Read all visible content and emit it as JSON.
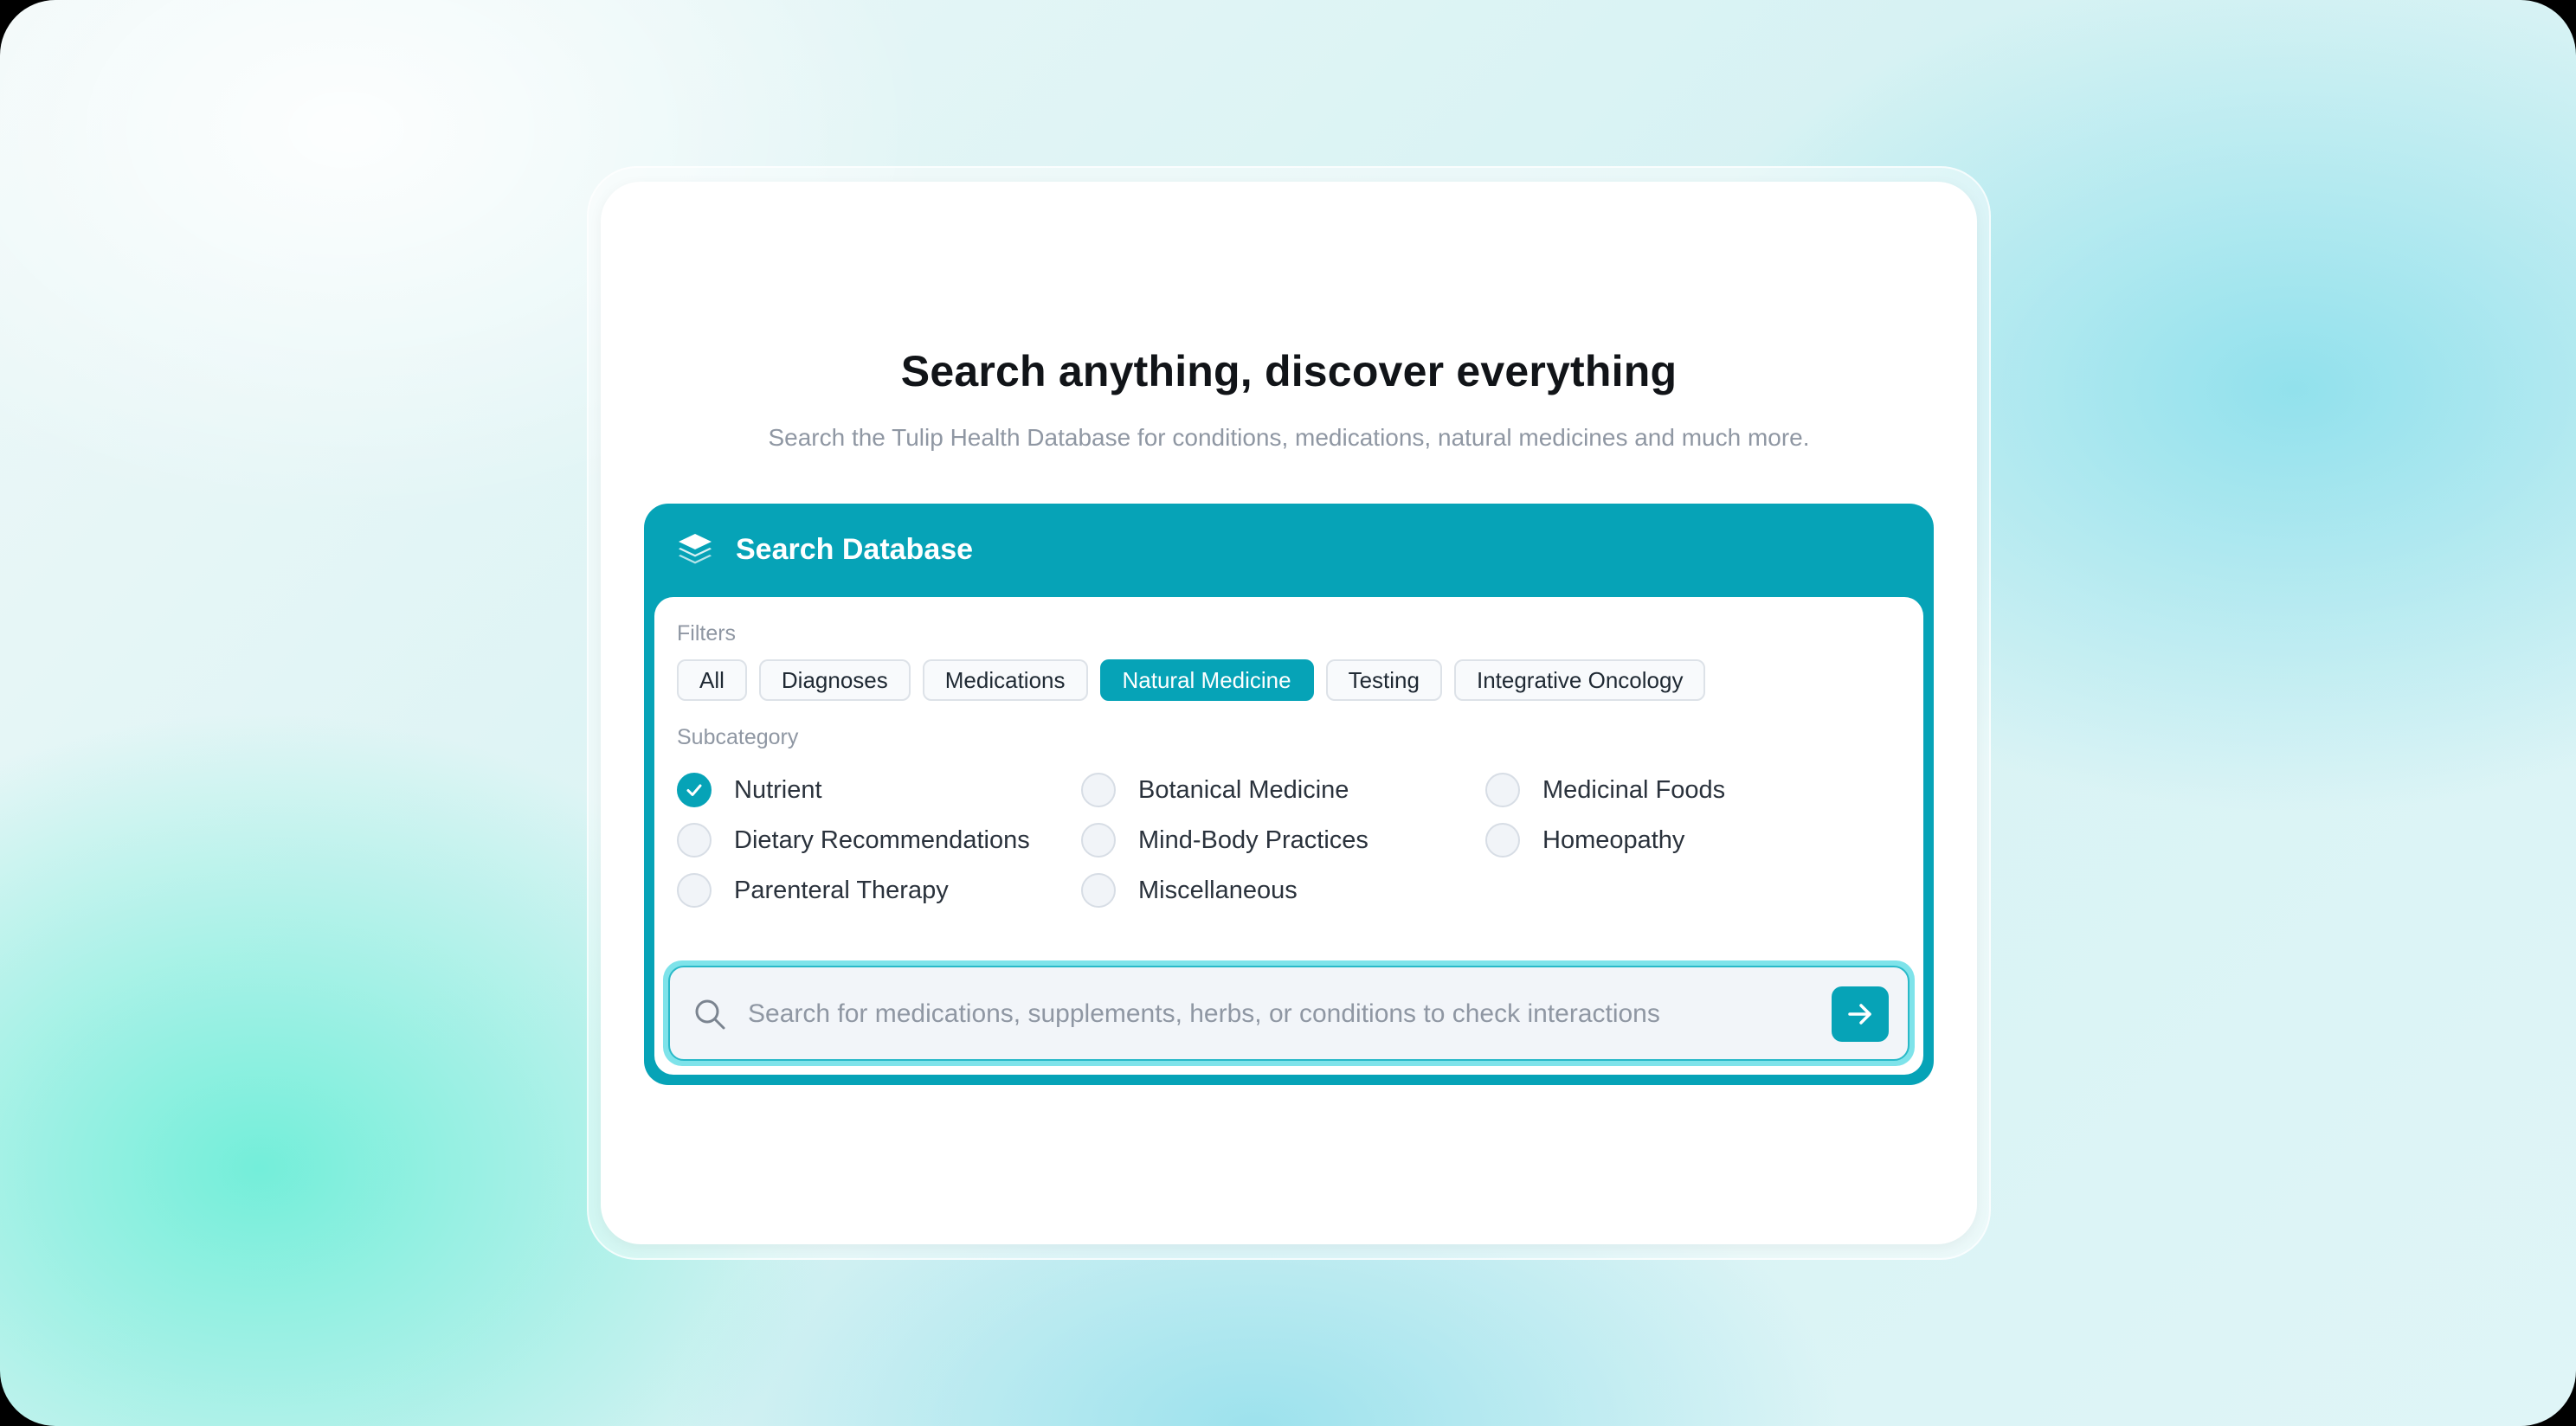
{
  "hero": {
    "title": "Search anything, discover everything",
    "subtitle": "Search the Tulip Health Database for conditions, medications, natural medicines and much more."
  },
  "panel": {
    "title": "Search Database",
    "icon": "layers-icon",
    "accent_color": "#06a3b7"
  },
  "filters": {
    "label": "Filters",
    "items": [
      {
        "label": "All",
        "active": false
      },
      {
        "label": "Diagnoses",
        "active": false
      },
      {
        "label": "Medications",
        "active": false
      },
      {
        "label": "Natural Medicine",
        "active": true
      },
      {
        "label": "Testing",
        "active": false
      },
      {
        "label": "Integrative Oncology",
        "active": false
      }
    ]
  },
  "subcategory": {
    "label": "Subcategory",
    "items": [
      {
        "label": "Nutrient",
        "checked": true
      },
      {
        "label": "Botanical Medicine",
        "checked": false
      },
      {
        "label": "Medicinal Foods",
        "checked": false
      },
      {
        "label": "Dietary Recommendations",
        "checked": false
      },
      {
        "label": "Mind-Body Practices",
        "checked": false
      },
      {
        "label": "Homeopathy",
        "checked": false
      },
      {
        "label": "Parenteral Therapy",
        "checked": false
      },
      {
        "label": "Miscellaneous",
        "checked": false
      }
    ]
  },
  "search": {
    "placeholder": "Search for medications, supplements, herbs, or conditions to check interactions",
    "value": "",
    "search_icon": "search-icon",
    "submit_icon": "arrow-right-icon"
  }
}
